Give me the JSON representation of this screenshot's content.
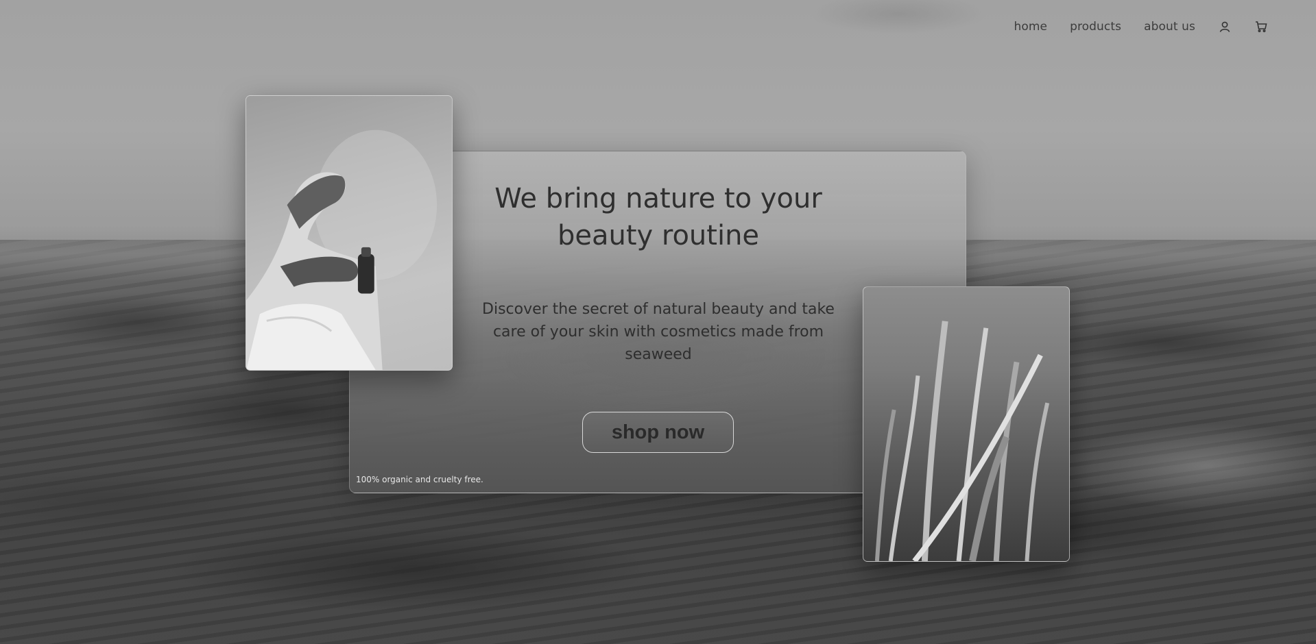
{
  "nav": {
    "links": [
      "home",
      "products",
      "about us"
    ],
    "account_icon": "user-icon",
    "cart_icon": "cart-icon"
  },
  "hero": {
    "title": "We bring nature to your beauty routine",
    "subtitle": "Discover the secret of natural beauty and take care of your skin with cosmetics made from seaweed",
    "cta_label": "shop now",
    "footnote": "100% organic and cruelty free."
  },
  "images": {
    "left": "photo-hands-holding-dropper-bottle",
    "right": "photo-underwater-seaweed"
  },
  "colors": {
    "background": "#8c8c8c",
    "text": "#2b2b2b",
    "button": "#636363",
    "button_border": "#d9d9d9"
  }
}
